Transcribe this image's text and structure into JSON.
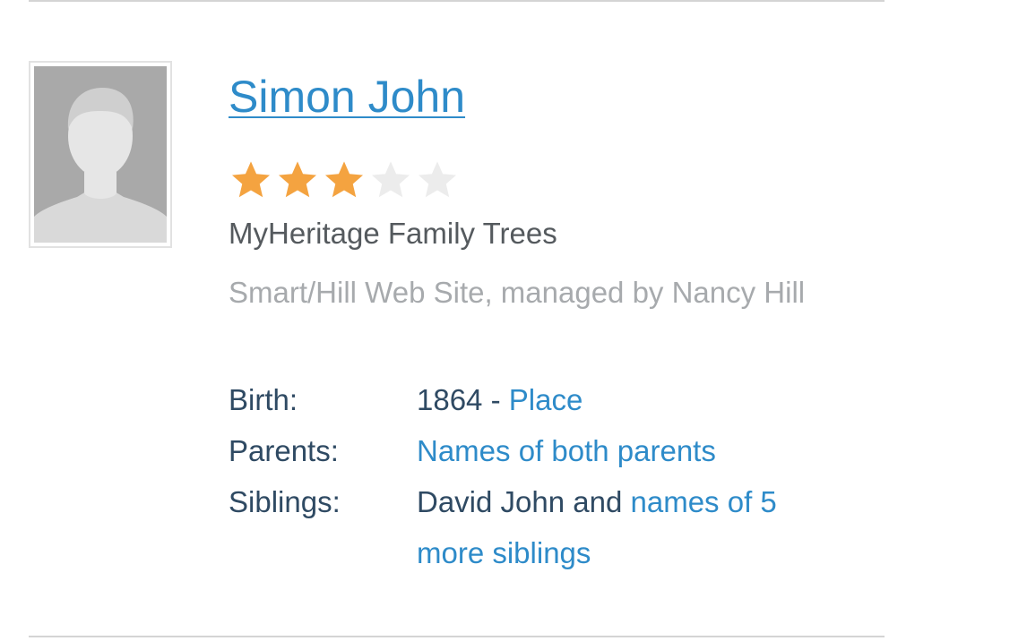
{
  "record": {
    "name": "Simon John",
    "rating": 3,
    "rating_max": 5,
    "source": "MyHeritage Family Trees",
    "site": "Smart/Hill Web Site, managed by Nancy Hill",
    "facts": {
      "birth": {
        "label": "Birth:",
        "year": "1864",
        "separator": " - ",
        "place_link": "Place"
      },
      "parents": {
        "label": "Parents:",
        "link": "Names of both parents"
      },
      "siblings": {
        "label": "Siblings:",
        "known": "David John and ",
        "link": "names of 5 more siblings"
      }
    }
  },
  "colors": {
    "link": "#2e8bc9",
    "star_filled": "#f4a340",
    "star_empty": "#ececec",
    "label": "#2f4a63",
    "muted": "#a7aaad",
    "divider": "#d4d4d4"
  },
  "icons": {
    "avatar": "silhouette-placeholder-icon",
    "star": "star-icon"
  }
}
